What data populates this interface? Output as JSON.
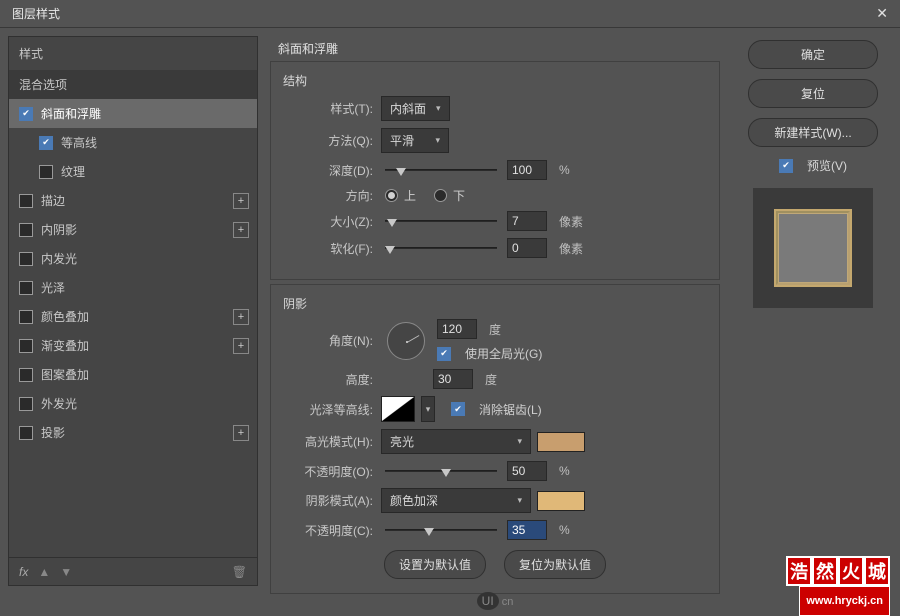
{
  "window": {
    "title": "图层样式"
  },
  "left": {
    "styles_header": "样式",
    "blend_options": "混合选项",
    "items": [
      {
        "label": "斜面和浮雕",
        "checked": true,
        "hasPlus": false,
        "selected": true
      },
      {
        "label": "等高线",
        "checked": true,
        "hasPlus": false,
        "selected": false,
        "sub": true
      },
      {
        "label": "纹理",
        "checked": false,
        "hasPlus": false,
        "selected": false,
        "sub": true
      },
      {
        "label": "描边",
        "checked": false,
        "hasPlus": true
      },
      {
        "label": "内阴影",
        "checked": false,
        "hasPlus": true
      },
      {
        "label": "内发光",
        "checked": false,
        "hasPlus": false
      },
      {
        "label": "光泽",
        "checked": false,
        "hasPlus": false
      },
      {
        "label": "颜色叠加",
        "checked": false,
        "hasPlus": true
      },
      {
        "label": "渐变叠加",
        "checked": false,
        "hasPlus": true
      },
      {
        "label": "图案叠加",
        "checked": false,
        "hasPlus": false
      },
      {
        "label": "外发光",
        "checked": false,
        "hasPlus": false
      },
      {
        "label": "投影",
        "checked": false,
        "hasPlus": true
      }
    ],
    "fx_label": "fx"
  },
  "center": {
    "section_title": "斜面和浮雕",
    "structure": {
      "title": "结构",
      "style_label": "样式(T):",
      "style_value": "内斜面",
      "technique_label": "方法(Q):",
      "technique_value": "平滑",
      "depth_label": "深度(D):",
      "depth_value": "100",
      "depth_unit": "%",
      "direction_label": "方向:",
      "direction_up": "上",
      "direction_down": "下",
      "size_label": "大小(Z):",
      "size_value": "7",
      "size_unit": "像素",
      "soften_label": "软化(F):",
      "soften_value": "0",
      "soften_unit": "像素"
    },
    "shading": {
      "title": "阴影",
      "angle_label": "角度(N):",
      "angle_value": "120",
      "angle_unit": "度",
      "global_light": "使用全局光(G)",
      "altitude_label": "高度:",
      "altitude_value": "30",
      "altitude_unit": "度",
      "gloss_contour_label": "光泽等高线:",
      "antialias": "消除锯齿(L)",
      "highlight_mode_label": "高光模式(H):",
      "highlight_mode_value": "亮光",
      "highlight_opacity_label": "不透明度(O):",
      "highlight_opacity_value": "50",
      "highlight_opacity_unit": "%",
      "highlight_color": "#c89e6e",
      "shadow_mode_label": "阴影模式(A):",
      "shadow_mode_value": "颜色加深",
      "shadow_opacity_label": "不透明度(C):",
      "shadow_opacity_value": "35",
      "shadow_opacity_unit": "%",
      "shadow_color": "#e0b878"
    },
    "buttons": {
      "make_default": "设置为默认值",
      "reset_default": "复位为默认值"
    }
  },
  "right": {
    "ok": "确定",
    "cancel": "复位",
    "new_style": "新建样式(W)...",
    "preview": "预览(V)"
  },
  "footer_logo": "UI",
  "watermark": {
    "c1": "浩",
    "c2": "然",
    "c3": "火",
    "c4": "城",
    "url": "www.hryckj.cn"
  }
}
